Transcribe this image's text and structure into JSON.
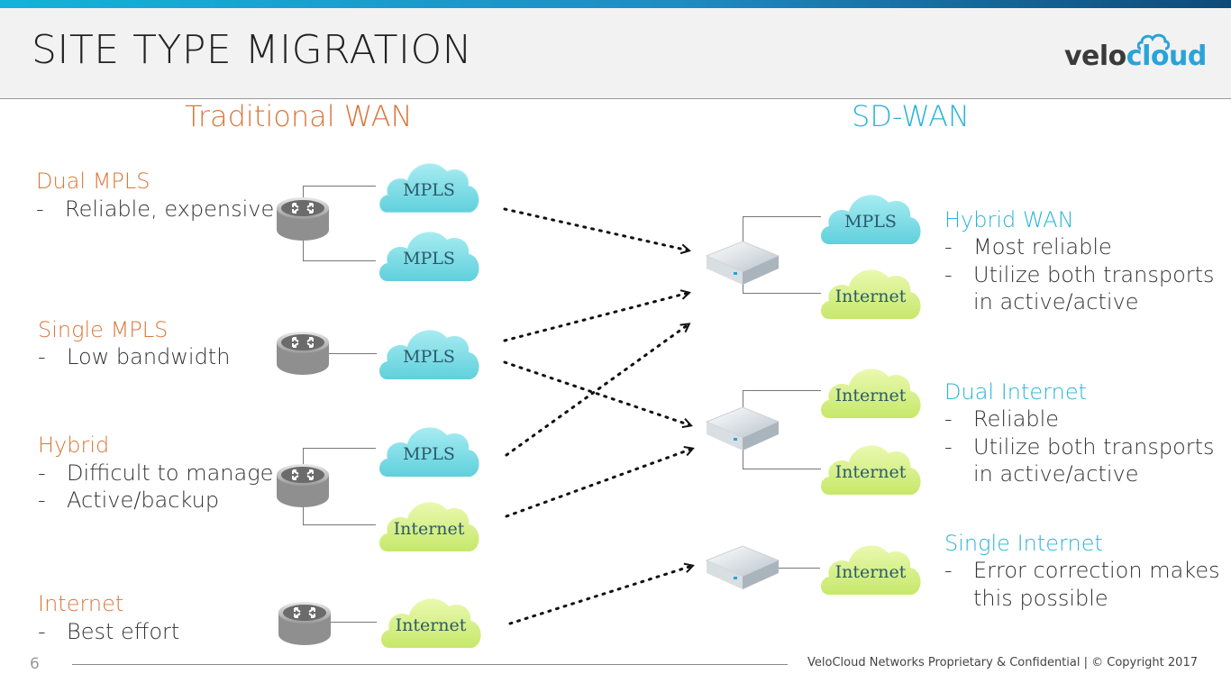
{
  "header": {
    "title": "SITE TYPE MIGRATION",
    "logo_left": "velo",
    "logo_right": "cloud"
  },
  "columns": {
    "traditional": "Traditional WAN",
    "sdwan": "SD-WAN"
  },
  "traditional_sites": [
    {
      "name": "Dual MPLS",
      "bullets": [
        "Reliable, expensive"
      ],
      "clouds": [
        "MPLS",
        "MPLS"
      ]
    },
    {
      "name": "Single MPLS",
      "bullets": [
        "Low bandwidth"
      ],
      "clouds": [
        "MPLS"
      ]
    },
    {
      "name": "Hybrid",
      "bullets": [
        "Difficult to manage",
        "Active/backup"
      ],
      "clouds": [
        "MPLS",
        "Internet"
      ]
    },
    {
      "name": "Internet",
      "bullets": [
        "Best effort"
      ],
      "clouds": [
        "Internet"
      ]
    }
  ],
  "sdwan_sites": [
    {
      "name": "Hybrid WAN",
      "bullets": [
        "Most reliable",
        "Utilize both transports",
        "in active/active"
      ],
      "clouds": [
        "MPLS",
        "Internet"
      ]
    },
    {
      "name": "Dual Internet",
      "bullets": [
        "Reliable",
        "Utilize both transports",
        "in active/active"
      ],
      "clouds": [
        "Internet",
        "Internet"
      ]
    },
    {
      "name": "Single Internet",
      "bullets": [
        "Error correction makes",
        "this possible"
      ],
      "clouds": [
        "Internet"
      ]
    }
  ],
  "migrations": [
    {
      "from": "Dual MPLS",
      "to": "Hybrid WAN"
    },
    {
      "from": "Single MPLS",
      "to": "Hybrid WAN"
    },
    {
      "from": "Single MPLS",
      "to": "Dual Internet"
    },
    {
      "from": "Hybrid",
      "to": "Hybrid WAN"
    },
    {
      "from": "Hybrid",
      "to": "Dual Internet"
    },
    {
      "from": "Internet",
      "to": "Single Internet"
    }
  ],
  "colors": {
    "orange": "#d9773a",
    "blue": "#2ab4d8",
    "mpls_cloud": "#7fdde6",
    "internet_cloud": "#d6f08a"
  },
  "footer": {
    "page_number": "6",
    "text": "VeloCloud Networks Proprietary & Confidential  |  © Copyright 2017"
  }
}
